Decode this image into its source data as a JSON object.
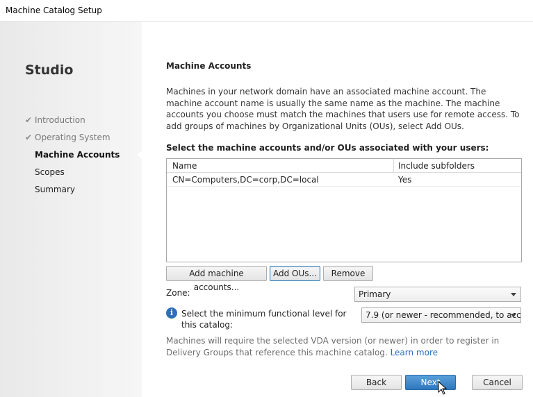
{
  "window": {
    "title": "Machine Catalog Setup"
  },
  "sidebar": {
    "brand": "Studio",
    "steps": [
      {
        "label": "Introduction",
        "state": "completed"
      },
      {
        "label": "Operating System",
        "state": "completed"
      },
      {
        "label": "Machine Accounts",
        "state": "active"
      },
      {
        "label": "Scopes",
        "state": "pending"
      },
      {
        "label": "Summary",
        "state": "pending"
      }
    ],
    "check_glyph": "✔"
  },
  "main": {
    "heading": "Machine Accounts",
    "description": "Machines in your network domain have an associated machine account. The machine account name is usually the same name as the machine. The machine accounts you choose must match the machines that users use for remote access. To add groups of machines by Organizational Units (OUs), select Add OUs.",
    "select_label": "Select the machine accounts and/or OUs associated with your users:",
    "table": {
      "columns": [
        "Name",
        "Include subfolders"
      ],
      "rows": [
        [
          "CN=Computers,DC=corp,DC=local",
          "Yes"
        ]
      ]
    },
    "buttons": {
      "add_accounts": "Add machine accounts...",
      "add_ous": "Add OUs...",
      "remove": "Remove"
    },
    "zone": {
      "label": "Zone:",
      "value": "Primary"
    },
    "functional_level": {
      "label": "Select the minimum functional level for this catalog:",
      "value": "7.9 (or newer - recommended, to acc..."
    },
    "note": {
      "text": "Machines will require the selected VDA version (or newer) in order to register in Delivery Groups that reference this machine catalog.",
      "link": "Learn more"
    }
  },
  "footer": {
    "back": "Back",
    "next": "Next",
    "cancel": "Cancel"
  },
  "colors": {
    "accent": "#2f77bd",
    "link": "#2a6cc0",
    "info": "#2f6fb8"
  }
}
